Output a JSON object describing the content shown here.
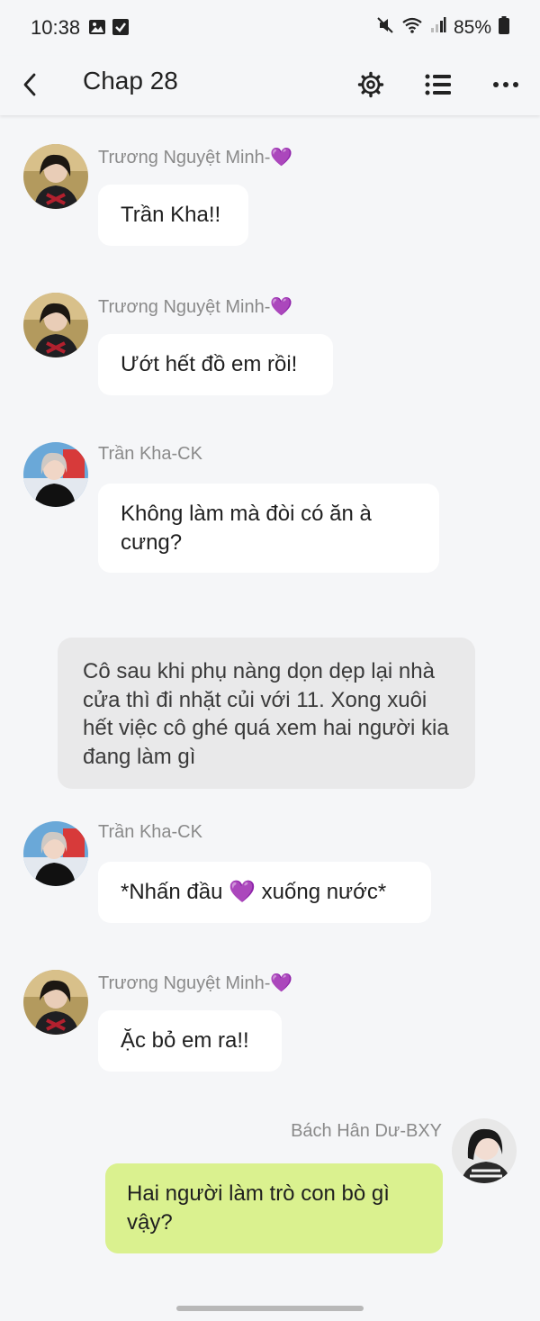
{
  "status_bar": {
    "time": "10:38",
    "battery": "85%",
    "icons": [
      "image-icon",
      "check-square-icon",
      "mute-icon",
      "wifi-icon",
      "signal-icon",
      "battery-icon"
    ]
  },
  "header": {
    "title": "Chap 28",
    "icons": [
      "back-icon",
      "gear-icon",
      "list-icon",
      "more-icon"
    ]
  },
  "messages": [
    {
      "sender": "Trương Nguyệt Minh-💜",
      "text": "Trần Kha!!"
    },
    {
      "sender": "Trương Nguyệt Minh-💜",
      "text": "Ướt hết đồ em rồi!"
    },
    {
      "sender": "Trần Kha-CK",
      "text": "Không làm mà đòi có ăn à cưng?"
    },
    {
      "sender": "Trần Kha-CK",
      "text": "*Nhấn đầu 💜 xuống nước*"
    },
    {
      "sender": "Trương Nguyệt Minh-💜",
      "text": "Ặc bỏ em ra!!"
    }
  ],
  "narration": "Cô sau khi phụ nàng dọn dẹp lại nhà cửa thì đi nhặt củi với 11. Xong xuôi hết việc cô ghé quá xem hai người kia đang làm gì",
  "my_message": {
    "sender": "Bách Hân Dư-BXY",
    "text": "Hai người làm trò con bò gì vậy?"
  },
  "colors": {
    "background": "#f5f6f8",
    "bubble": "#ffffff",
    "my_bubble": "#daf18f",
    "narration": "#e9e9ea",
    "sender_text": "#8a8a8a"
  }
}
